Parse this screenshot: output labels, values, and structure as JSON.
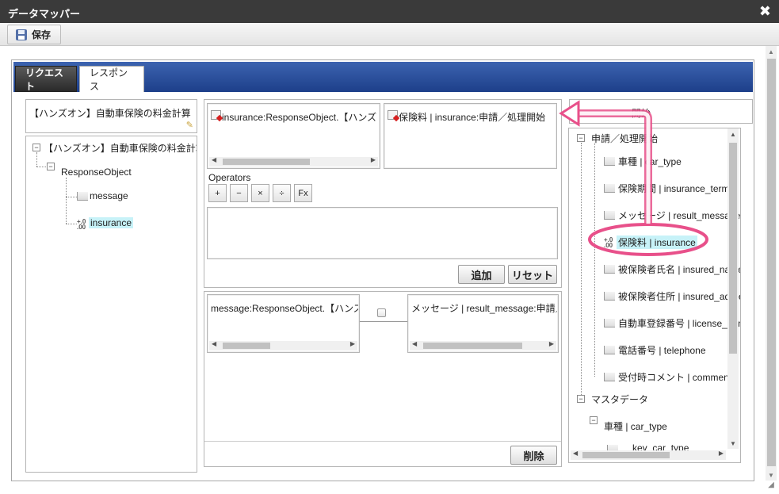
{
  "window": {
    "title": "データマッパー",
    "close_glyph": "✖"
  },
  "toolbar": {
    "save_label": "保存"
  },
  "tabs": [
    {
      "label": "リクエスト",
      "active": false
    },
    {
      "label": "レスポンス",
      "active": true
    }
  ],
  "left_panel": {
    "title": "【ハンズオン】自動車保険の料金計算",
    "tree": {
      "root": "【ハンズオン】自動車保険の料金計算",
      "child": "ResponseObject",
      "leaves": [
        "message",
        "insurance"
      ]
    }
  },
  "mapping": {
    "source_field": "insurance:ResponseObject.【ハンズオ",
    "target_field": "保険料 | insurance:申請／処理開始",
    "operators_label": "Operators",
    "operators": [
      "+",
      "−",
      "×",
      "÷",
      "Fx"
    ],
    "add_button": "追加",
    "reset_button": "リセット"
  },
  "mapped_list": {
    "row": {
      "source": "message:ResponseObject.【ハンズ",
      "target": "メッセージ | result_message:申請／"
    },
    "delete_button": "削除"
  },
  "right_panel": {
    "header": "開始",
    "group1": "申請／処理開始",
    "fields": [
      "車種 | car_type",
      "保険期間 | insurance_term",
      "メッセージ | result_message",
      "保険料 | insurance",
      "被保険者氏名 | insured_name",
      "被保険者住所 | insured_address",
      "自動車登録番号 | license_number",
      "電話番号 | telephone",
      "受付時コメント | comment"
    ],
    "group2": "マスタデータ",
    "group2_child": "車種 | car_type",
    "group2_leaf": "key_car_type"
  },
  "colors": {
    "tab_bar": "#2a4c9c",
    "highlight": "#c7f2f8",
    "annotation": "#e8508a"
  }
}
